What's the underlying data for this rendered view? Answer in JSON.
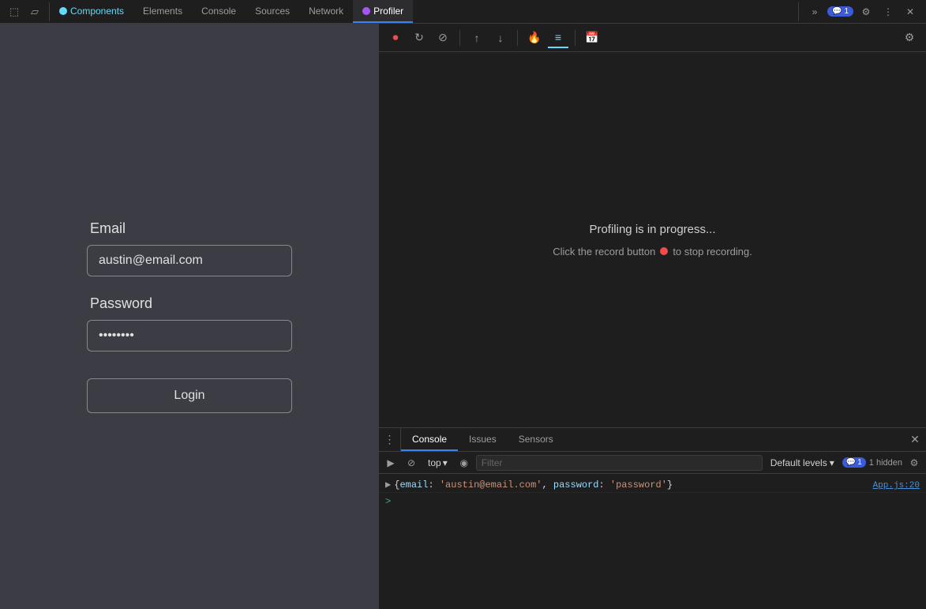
{
  "devtools": {
    "tabs": [
      {
        "id": "components",
        "label": "Components",
        "active": false,
        "dot": "react"
      },
      {
        "id": "elements",
        "label": "Elements",
        "active": false,
        "dot": null
      },
      {
        "id": "console",
        "label": "Console",
        "active": false,
        "dot": null
      },
      {
        "id": "sources",
        "label": "Sources",
        "active": false,
        "dot": null
      },
      {
        "id": "network",
        "label": "Network",
        "active": false,
        "dot": null
      },
      {
        "id": "profiler",
        "label": "Profiler",
        "active": true,
        "dot": "profiler"
      }
    ],
    "badge_count": "1",
    "more_tabs_label": "»"
  },
  "profiler": {
    "toolbar": {
      "record_label": "⏺",
      "reload_label": "↺",
      "stop_label": "⊘",
      "upload_label": "↑",
      "download_label": "↓",
      "flame_label": "🔥",
      "ranked_label": "≡",
      "timeline_label": "📅",
      "settings_label": "⚙"
    },
    "status_title": "Profiling is in progress...",
    "status_subtitle_before": "Click the record button",
    "status_subtitle_after": "to stop recording.",
    "settings_btn_label": "⚙"
  },
  "console_panel": {
    "tabs": [
      {
        "id": "console",
        "label": "Console",
        "active": true
      },
      {
        "id": "issues",
        "label": "Issues",
        "active": false
      },
      {
        "id": "sensors",
        "label": "Sensors",
        "active": false
      }
    ],
    "toolbar": {
      "execute_label": "▶",
      "stop_label": "⊘",
      "top_label": "top",
      "eye_label": "◉",
      "filter_placeholder": "Filter",
      "default_levels_label": "Default levels",
      "issue_count": "1",
      "hidden_count": "1 hidden",
      "settings_label": "⚙"
    },
    "log_lines": [
      {
        "arrow": "▶",
        "content_parts": [
          {
            "type": "punct",
            "text": "{"
          },
          {
            "type": "key",
            "text": "email"
          },
          {
            "type": "punct",
            "text": ": "
          },
          {
            "type": "string",
            "text": "'austin@email.com'"
          },
          {
            "type": "punct",
            "text": ", "
          },
          {
            "type": "key",
            "text": "password"
          },
          {
            "type": "punct",
            "text": ": "
          },
          {
            "type": "string",
            "text": "'password'"
          },
          {
            "type": "punct",
            "text": "}"
          }
        ],
        "source": "App.js:20"
      }
    ],
    "prompt_symbol": ">"
  },
  "app": {
    "email_label": "Email",
    "email_value": "austin@email.com",
    "password_label": "Password",
    "password_value": "•••••••",
    "login_label": "Login"
  }
}
